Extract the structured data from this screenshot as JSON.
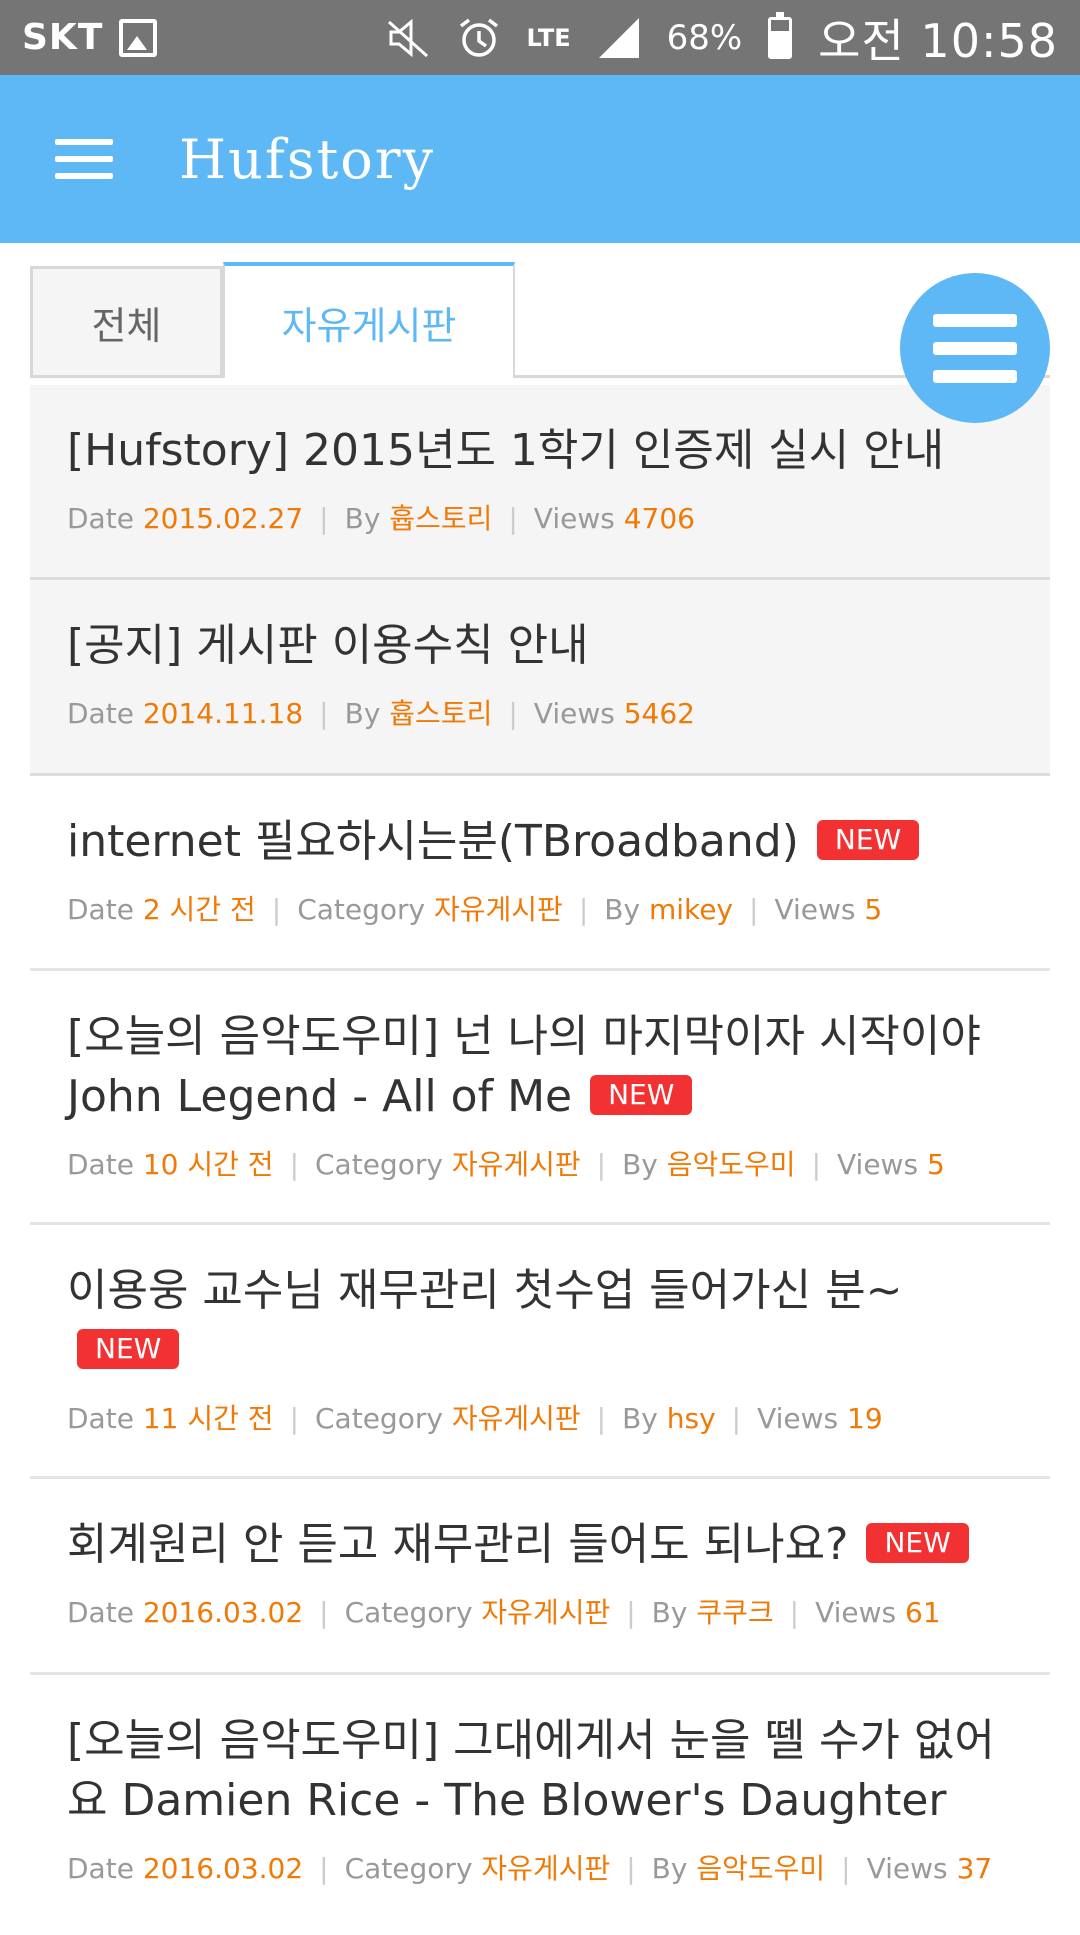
{
  "status_bar": {
    "carrier": "SKT",
    "network": "LTE",
    "battery": "68%",
    "time": "오전 10:58"
  },
  "app_bar": {
    "title": "Hufstory"
  },
  "tabs": [
    {
      "label": "전체",
      "active": false
    },
    {
      "label": "자유게시판",
      "active": true
    }
  ],
  "meta_labels": {
    "date": "Date",
    "category": "Category",
    "by": "By",
    "views": "Views",
    "new": "NEW"
  },
  "posts": [
    {
      "title": "[Hufstory] 2015년도 1학기 인증제 실시 안내",
      "date": "2015.02.27",
      "author": "흅스토리",
      "views": "4706",
      "notice": true
    },
    {
      "title": "[공지] 게시판 이용수칙 안내",
      "date": "2014.11.18",
      "author": "흅스토리",
      "views": "5462",
      "notice": true
    },
    {
      "title": "internet 필요하시는분(TBroadband)",
      "date": "2 시간 전",
      "category": "자유게시판",
      "author": "mikey",
      "views": "5",
      "new": true
    },
    {
      "title": "[오늘의 음악도우미] 넌 나의 마지막이자 시작이야 John Legend - All of Me",
      "date": "10 시간 전",
      "category": "자유게시판",
      "author": "음악도우미",
      "views": "5",
      "new": true
    },
    {
      "title": "이용웅 교수님 재무관리 첫수업 들어가신 분~",
      "date": "11 시간 전",
      "category": "자유게시판",
      "author": "hsy",
      "views": "19",
      "new": true
    },
    {
      "title": "회계원리 안 듣고 재무관리 들어도 되나요?",
      "date": "2016.03.02",
      "category": "자유게시판",
      "author": "쿠쿠크",
      "views": "61",
      "new": true
    },
    {
      "title": "[오늘의 음악도우미] 그대에게서 눈을 뗄 수가 없어요 Damien Rice - The Blower's Daughter",
      "date": "2016.03.02",
      "category": "자유게시판",
      "author": "음악도우미",
      "views": "37"
    }
  ],
  "colors": {
    "primary": "#5db8f5",
    "status_bar": "#757575",
    "accent_value": "#f07a08",
    "new_badge": "#f23232"
  }
}
